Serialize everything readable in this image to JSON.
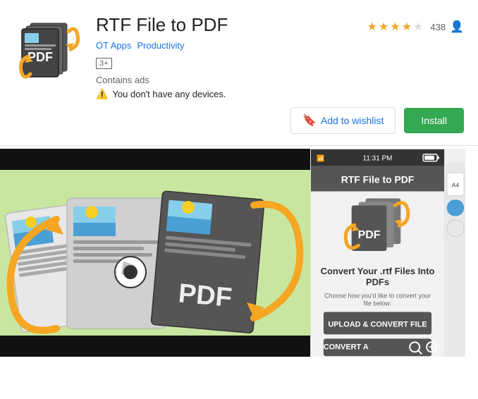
{
  "app": {
    "title": "RTF File to PDF",
    "developer": "OT Apps",
    "category": "Productivity",
    "rating_value": 4,
    "rating_max": 5,
    "rating_count": "438",
    "age_rating": "3+",
    "contains_ads": "Contains ads",
    "warning_text": "You don't have any devices.",
    "wishlist_label": "Add to wishlist",
    "install_label": "Install",
    "phone_title": "RTF File to PDF",
    "phone_subtitle": "Convert Your .rtf Files Into PDFs",
    "phone_description": "Choose how you'd like to convert your file below:",
    "upload_button": "UPLOAD & CONVERT FILE",
    "convert_button": "CONVERT A",
    "time": "11:31 PM"
  },
  "stars": [
    true,
    true,
    true,
    true,
    false
  ],
  "icons": {
    "warning": "⚠",
    "wishlist": "🔖",
    "user": "👤"
  }
}
